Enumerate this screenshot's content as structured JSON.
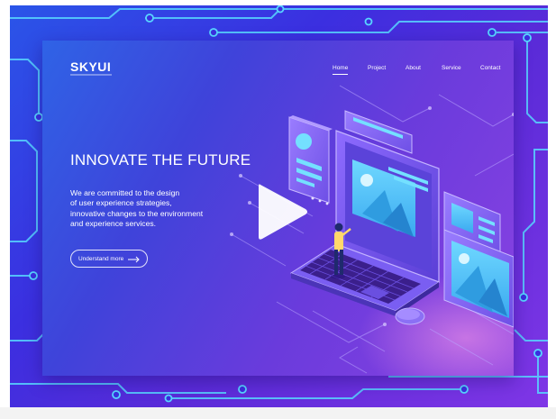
{
  "brand": {
    "logo_text": "SKYUI"
  },
  "nav": {
    "items": [
      {
        "label": "Home",
        "active": true
      },
      {
        "label": "Project",
        "active": false
      },
      {
        "label": "About",
        "active": false
      },
      {
        "label": "Service",
        "active": false
      },
      {
        "label": "Contact",
        "active": false
      }
    ]
  },
  "hero": {
    "headline": "INNOVATE THE FUTURE",
    "body_lines": [
      "We are committed to the design",
      "of user experience strategies,",
      "innovative changes to the environment",
      "and experience services."
    ],
    "cta_label": "Understand more"
  },
  "video": {
    "play_icon": "play-icon"
  },
  "colors": {
    "outer_bg": "#3b2fe0",
    "circuit_line": "#5fe0ff",
    "panel_start": "#2f63e6",
    "panel_end": "#8a42e2",
    "text": "#ffffff"
  }
}
